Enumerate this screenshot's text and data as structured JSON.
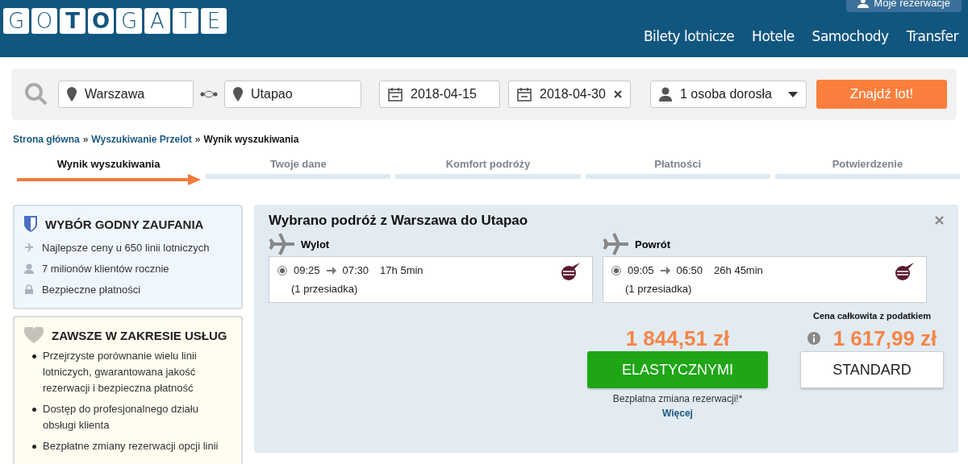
{
  "header": {
    "logo": [
      {
        "char": "G",
        "bold": false
      },
      {
        "char": "O",
        "bold": false
      },
      {
        "char": "T",
        "bold": true
      },
      {
        "char": "O",
        "bold": true
      },
      {
        "char": "G",
        "bold": false
      },
      {
        "char": "A",
        "bold": false
      },
      {
        "char": "T",
        "bold": false
      },
      {
        "char": "E",
        "bold": false
      }
    ],
    "account_button": "Moje rezerwacje",
    "nav": [
      "Bilety lotnicze",
      "Hotele",
      "Samochody",
      "Transfer"
    ]
  },
  "search": {
    "from": "Warszawa",
    "to": "Utapao",
    "depart": "2018-04-15",
    "return": "2018-04-30",
    "passengers": "1 osoba dorosła",
    "submit": "Znajdź lot!"
  },
  "breadcrumb": [
    {
      "label": "Strona główna",
      "link": true
    },
    {
      "sep": "»",
      "label": "Wyszukiwanie Przelot",
      "link": true
    },
    {
      "sep": "»",
      "label": "Wynik wyszukiwania",
      "link": false
    }
  ],
  "steps": [
    {
      "label": "Wynik wyszukiwania",
      "selected": true
    },
    {
      "label": "Twoje dane",
      "selected": false
    },
    {
      "label": "Komfort podróży",
      "selected": false
    },
    {
      "label": "Płatności",
      "selected": false
    },
    {
      "label": "Potwierdzenie",
      "selected": false
    }
  ],
  "trust": {
    "title": "WYBÓR GODNY ZAUFANIA",
    "items": [
      {
        "kind": "plane",
        "text": "Najlepsze ceny u 650 linii lotniczych"
      },
      {
        "kind": "person",
        "text": "7 milionów klientów rocznie"
      },
      {
        "kind": "lock",
        "text": "Bezpieczne płatności"
      }
    ]
  },
  "service": {
    "title": "ZAWSZE W ZAKRESIE USŁUG",
    "items": [
      "Przejrzyste porównanie wielu linii lotniczych, gwarantowana jakość rezerwacji i bezpieczna płatność",
      "Dostęp do profesjonalnego działu obsługi klienta",
      "Bezpłatne zmiany rezerwacji opcji linii"
    ]
  },
  "selection": {
    "title": "Wybrano podróż z Warszawa do Utapao",
    "legs": [
      {
        "label": "Wylot",
        "selected": true,
        "dep": "09:25",
        "arr": "07:30",
        "duration": "17h 5min",
        "stops": "(1 przesiadka)"
      },
      {
        "label": "Powrót",
        "selected": true,
        "dep": "09:05",
        "arr": "06:50",
        "duration": "26h 45min",
        "stops": "(1 przesiadka)"
      }
    ],
    "total_label": "Cena całkowita z podatkiem",
    "options": [
      {
        "kind": "flex",
        "price": "1 844,51 zł",
        "button": "ELASTYCZNYMI",
        "note": "Bezpłatna zmiana rezerwacji!*",
        "link": "Więcej"
      },
      {
        "kind": "standard",
        "price": "1 617,99 zł",
        "button": "STANDARD"
      }
    ]
  }
}
